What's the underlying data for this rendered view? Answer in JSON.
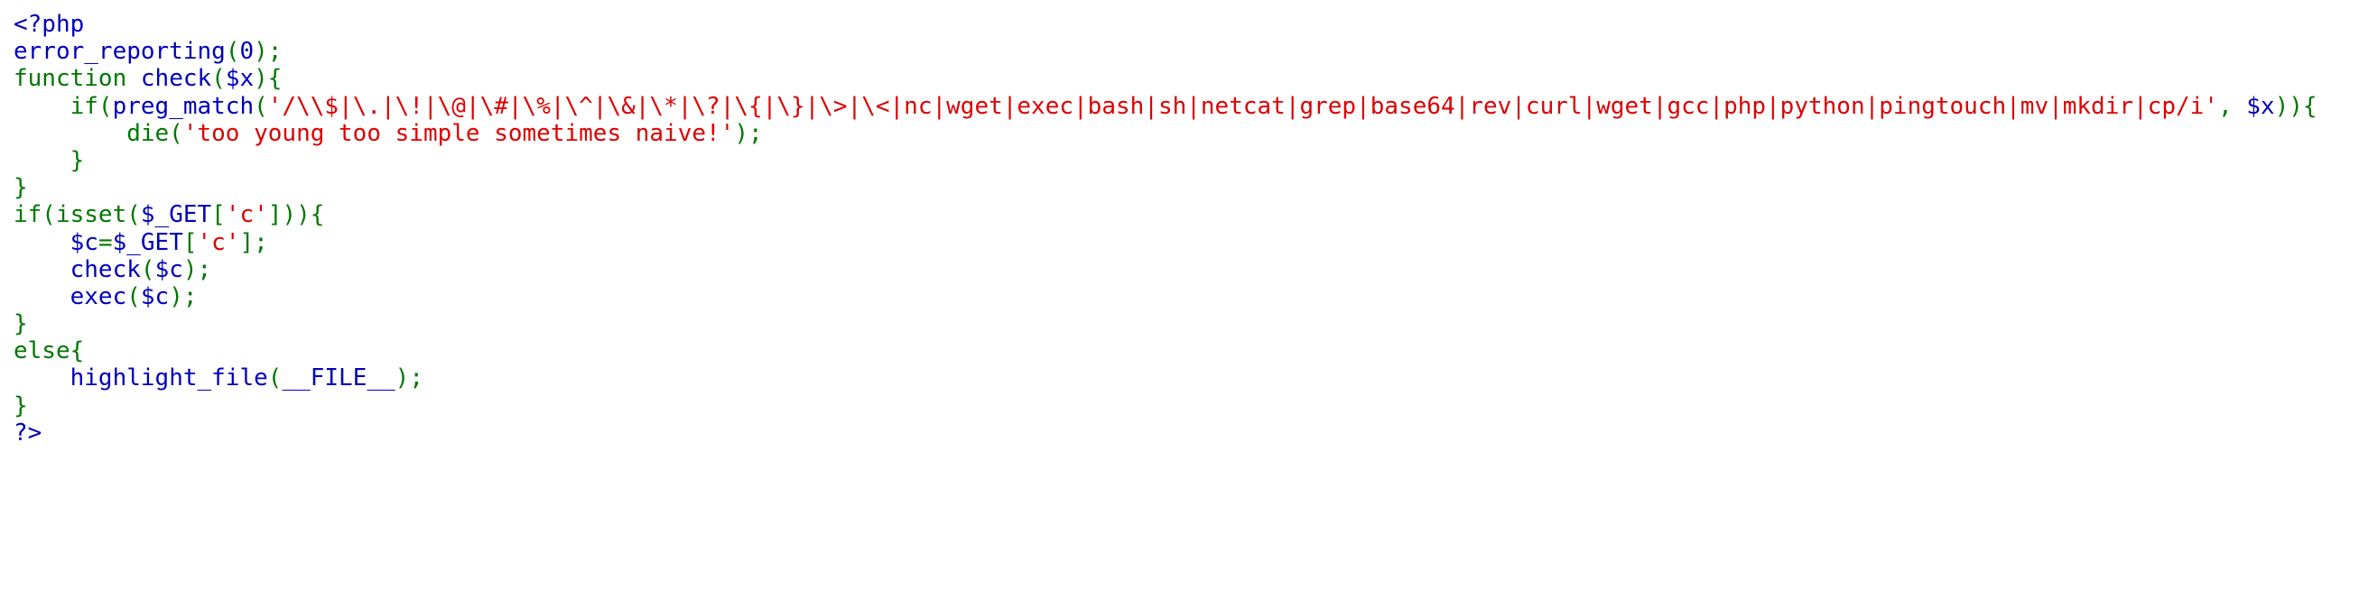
{
  "colors": {
    "default": "#0000BB",
    "keyword": "#007700",
    "string": "#DD0000",
    "background": "#FFFFFF"
  },
  "lines": [
    {
      "tokens": [
        {
          "t": "<?php",
          "c": "default"
        }
      ]
    },
    {
      "tokens": [
        {
          "t": "error_reporting",
          "c": "default"
        },
        {
          "t": "(",
          "c": "keyword"
        },
        {
          "t": "0",
          "c": "default"
        },
        {
          "t": ");",
          "c": "keyword"
        }
      ]
    },
    {
      "tokens": [
        {
          "t": "function ",
          "c": "keyword"
        },
        {
          "t": "check",
          "c": "default"
        },
        {
          "t": "(",
          "c": "keyword"
        },
        {
          "t": "$x",
          "c": "default"
        },
        {
          "t": "){",
          "c": "keyword"
        }
      ]
    },
    {
      "tokens": [
        {
          "t": "    if(",
          "c": "keyword"
        },
        {
          "t": "preg_match",
          "c": "default"
        },
        {
          "t": "(",
          "c": "keyword"
        },
        {
          "t": "'/\\\\$|\\.|\\!|\\@|\\#|\\%|\\^|\\&|\\*|\\?|\\{|\\}|\\>|\\<|nc|wget|exec|bash|sh|netcat|grep|base64|rev|curl|wget|gcc|php|python|pingtouch|mv|mkdir|cp/i'",
          "c": "string"
        },
        {
          "t": ", ",
          "c": "keyword"
        },
        {
          "t": "$x",
          "c": "default"
        },
        {
          "t": ")){",
          "c": "keyword"
        }
      ]
    },
    {
      "tokens": [
        {
          "t": "        die(",
          "c": "keyword"
        },
        {
          "t": "'too young too simple sometimes naive!'",
          "c": "string"
        },
        {
          "t": ");",
          "c": "keyword"
        }
      ]
    },
    {
      "tokens": [
        {
          "t": "    }",
          "c": "keyword"
        }
      ]
    },
    {
      "tokens": [
        {
          "t": "}",
          "c": "keyword"
        }
      ]
    },
    {
      "tokens": [
        {
          "t": "if(isset(",
          "c": "keyword"
        },
        {
          "t": "$_GET",
          "c": "default"
        },
        {
          "t": "[",
          "c": "keyword"
        },
        {
          "t": "'c'",
          "c": "string"
        },
        {
          "t": "])){",
          "c": "keyword"
        }
      ]
    },
    {
      "tokens": [
        {
          "t": "    ",
          "c": "keyword"
        },
        {
          "t": "$c",
          "c": "default"
        },
        {
          "t": "=",
          "c": "keyword"
        },
        {
          "t": "$_GET",
          "c": "default"
        },
        {
          "t": "[",
          "c": "keyword"
        },
        {
          "t": "'c'",
          "c": "string"
        },
        {
          "t": "];",
          "c": "keyword"
        }
      ]
    },
    {
      "tokens": [
        {
          "t": "    ",
          "c": "keyword"
        },
        {
          "t": "check",
          "c": "default"
        },
        {
          "t": "(",
          "c": "keyword"
        },
        {
          "t": "$c",
          "c": "default"
        },
        {
          "t": ");",
          "c": "keyword"
        }
      ]
    },
    {
      "tokens": [
        {
          "t": "    ",
          "c": "keyword"
        },
        {
          "t": "exec",
          "c": "default"
        },
        {
          "t": "(",
          "c": "keyword"
        },
        {
          "t": "$c",
          "c": "default"
        },
        {
          "t": ");",
          "c": "keyword"
        }
      ]
    },
    {
      "tokens": [
        {
          "t": "}",
          "c": "keyword"
        }
      ]
    },
    {
      "tokens": [
        {
          "t": "else{",
          "c": "keyword"
        }
      ]
    },
    {
      "tokens": [
        {
          "t": "    ",
          "c": "keyword"
        },
        {
          "t": "highlight_file",
          "c": "default"
        },
        {
          "t": "(",
          "c": "keyword"
        },
        {
          "t": "__FILE__",
          "c": "default"
        },
        {
          "t": ");",
          "c": "keyword"
        }
      ]
    },
    {
      "tokens": [
        {
          "t": "}",
          "c": "keyword"
        }
      ]
    },
    {
      "tokens": [
        {
          "t": "?>",
          "c": "default"
        }
      ]
    }
  ]
}
